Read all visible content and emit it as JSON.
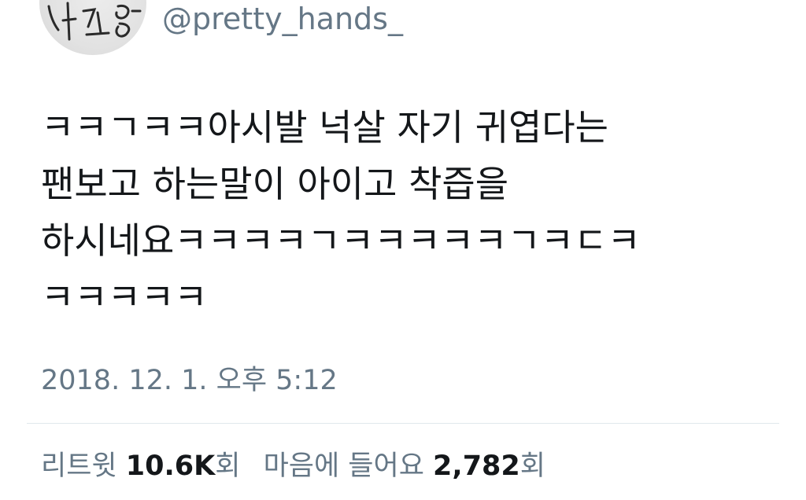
{
  "user": {
    "handle": "@pretty_hands_"
  },
  "tweet": {
    "lines": [
      "ㅋㅋㄱㅋㅋ아시발 넉살 자기 귀엽다는",
      "팬보고 하는말이 아이고 착즙을",
      "하시네요ㅋㅋㅋㅋㄱㅋㅋㅋㅋㅋㄱㅋㄷㅋ",
      "ㅋㅋㅋㅋㅋ"
    ],
    "timestamp": "2018. 12. 1. 오후 5:12"
  },
  "stats": {
    "retweets": {
      "label": "리트윗",
      "value": "10.6K",
      "suffix": "회"
    },
    "likes": {
      "label": "마음에 들어요",
      "value": "2,782",
      "suffix": "회"
    }
  },
  "icons": {
    "avatar": "profile-avatar-handwriting"
  }
}
